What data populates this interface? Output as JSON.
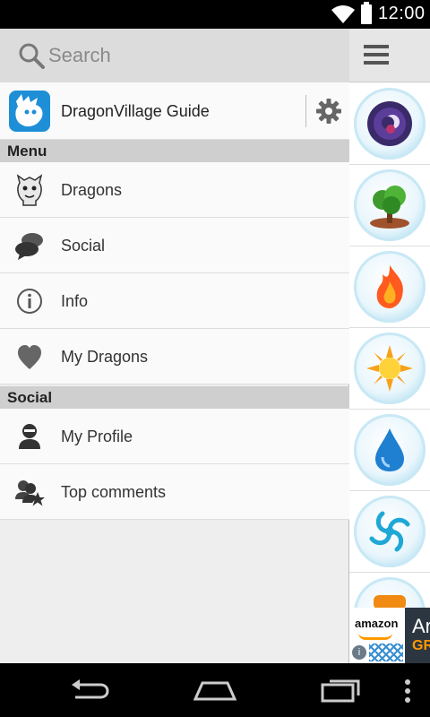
{
  "status_bar": {
    "time": "12:00"
  },
  "search": {
    "placeholder": "Search"
  },
  "app": {
    "name": "DragonVillage Guide"
  },
  "sections": {
    "menu_label": "Menu",
    "social_label": "Social"
  },
  "menu_items": [
    {
      "label": "Dragons",
      "icon": "dragon-icon"
    },
    {
      "label": "Social",
      "icon": "speech-bubbles-icon"
    },
    {
      "label": "Info",
      "icon": "info-icon"
    },
    {
      "label": "My Dragons",
      "icon": "heart-icon"
    }
  ],
  "social_items": [
    {
      "label": "My Profile",
      "icon": "person-icon"
    },
    {
      "label": "Top comments",
      "icon": "users-star-icon"
    }
  ],
  "elements": [
    "dark-element-icon",
    "forest-element-icon",
    "fire-element-icon",
    "light-element-icon",
    "water-element-icon",
    "wind-element-icon",
    "metal-element-icon"
  ],
  "ad": {
    "brand": "amazon",
    "line1": "Ar",
    "line2": "GR"
  },
  "colors": {
    "accent_orange": "#ff9900",
    "app_blue": "#1e8fd6",
    "section_grey": "#cfcfcf"
  }
}
